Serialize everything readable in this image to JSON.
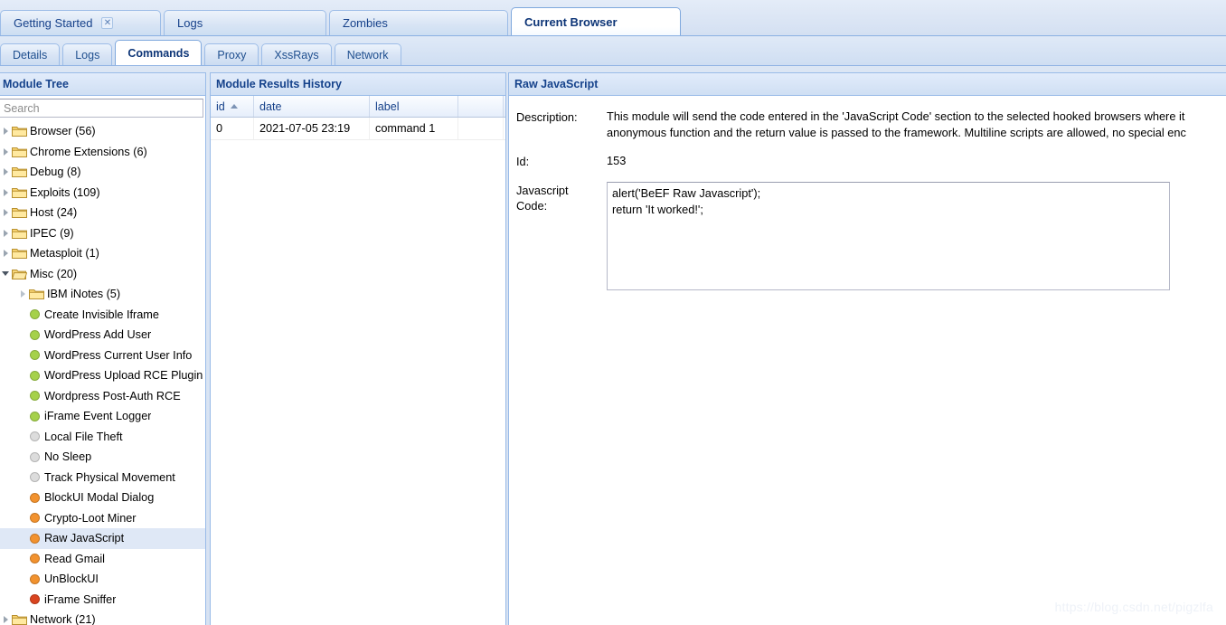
{
  "main_tabs": [
    {
      "label": "Getting Started",
      "active": false,
      "closable": true,
      "cls": "t-getting"
    },
    {
      "label": "Logs",
      "active": false,
      "closable": false,
      "cls": "t-logs"
    },
    {
      "label": "Zombies",
      "active": false,
      "closable": false,
      "cls": "t-zombies"
    },
    {
      "label": "Current Browser",
      "active": true,
      "closable": false,
      "cls": "t-current"
    }
  ],
  "sub_tabs": [
    {
      "label": "Details",
      "active": false
    },
    {
      "label": "Logs",
      "active": false
    },
    {
      "label": "Commands",
      "active": true
    },
    {
      "label": "Proxy",
      "active": false
    },
    {
      "label": "XssRays",
      "active": false
    },
    {
      "label": "Network",
      "active": false
    }
  ],
  "module_tree": {
    "title": "Module Tree",
    "search_placeholder": "Search",
    "search_value": "",
    "nodes": [
      {
        "type": "folder",
        "label": "Browser (56)",
        "depth": 0,
        "expanded": false,
        "selected": false
      },
      {
        "type": "folder",
        "label": "Chrome Extensions (6)",
        "depth": 0,
        "expanded": false,
        "selected": false
      },
      {
        "type": "folder",
        "label": "Debug (8)",
        "depth": 0,
        "expanded": false,
        "selected": false
      },
      {
        "type": "folder",
        "label": "Exploits (109)",
        "depth": 0,
        "expanded": false,
        "selected": false
      },
      {
        "type": "folder",
        "label": "Host (24)",
        "depth": 0,
        "expanded": false,
        "selected": false
      },
      {
        "type": "folder",
        "label": "IPEC (9)",
        "depth": 0,
        "expanded": false,
        "selected": false
      },
      {
        "type": "folder",
        "label": "Metasploit (1)",
        "depth": 0,
        "expanded": false,
        "selected": false
      },
      {
        "type": "folder",
        "label": "Misc (20)",
        "depth": 0,
        "expanded": true,
        "selected": false
      },
      {
        "type": "folder",
        "label": "IBM iNotes (5)",
        "depth": 1,
        "expanded": false,
        "selected": false
      },
      {
        "type": "module",
        "label": "Create Invisible Iframe",
        "depth": 1,
        "status": "green",
        "selected": false
      },
      {
        "type": "module",
        "label": "WordPress Add User",
        "depth": 1,
        "status": "green",
        "selected": false
      },
      {
        "type": "module",
        "label": "WordPress Current User Info",
        "depth": 1,
        "status": "green",
        "selected": false
      },
      {
        "type": "module",
        "label": "WordPress Upload RCE Plugin",
        "depth": 1,
        "status": "green",
        "selected": false
      },
      {
        "type": "module",
        "label": "Wordpress Post-Auth RCE",
        "depth": 1,
        "status": "green",
        "selected": false
      },
      {
        "type": "module",
        "label": "iFrame Event Logger",
        "depth": 1,
        "status": "green",
        "selected": false
      },
      {
        "type": "module",
        "label": "Local File Theft",
        "depth": 1,
        "status": "grey",
        "selected": false
      },
      {
        "type": "module",
        "label": "No Sleep",
        "depth": 1,
        "status": "grey",
        "selected": false
      },
      {
        "type": "module",
        "label": "Track Physical Movement",
        "depth": 1,
        "status": "grey",
        "selected": false
      },
      {
        "type": "module",
        "label": "BlockUI Modal Dialog",
        "depth": 1,
        "status": "orange",
        "selected": false
      },
      {
        "type": "module",
        "label": "Crypto-Loot Miner",
        "depth": 1,
        "status": "orange",
        "selected": false
      },
      {
        "type": "module",
        "label": "Raw JavaScript",
        "depth": 1,
        "status": "orange",
        "selected": true
      },
      {
        "type": "module",
        "label": "Read Gmail",
        "depth": 1,
        "status": "orange",
        "selected": false
      },
      {
        "type": "module",
        "label": "UnBlockUI",
        "depth": 1,
        "status": "orange",
        "selected": false
      },
      {
        "type": "module",
        "label": "iFrame Sniffer",
        "depth": 1,
        "status": "red",
        "selected": false
      },
      {
        "type": "folder",
        "label": "Network (21)",
        "depth": 0,
        "expanded": false,
        "selected": false
      }
    ],
    "status_colors": {
      "green": "#a5d14a",
      "grey": "#dcdcdc",
      "orange": "#f2922e",
      "red": "#d9441f"
    }
  },
  "results_history": {
    "title": "Module Results History",
    "columns": [
      "id",
      "date",
      "label",
      ""
    ],
    "sort_column": "id",
    "sort_direction": "asc",
    "rows": [
      {
        "id": "0",
        "date": "2021-07-05 23:19",
        "label": "command 1",
        "extra": ""
      }
    ]
  },
  "detail": {
    "title": "Raw JavaScript",
    "description_label": "Description:",
    "description_value": "This module will send the code entered in the 'JavaScript Code' section to the selected hooked browsers where it\nanonymous function and the return value is passed to the framework. Multiline scripts are allowed, no special enc",
    "id_label": "Id:",
    "id_value": "153",
    "code_label": "Javascript\nCode:",
    "code_value": "alert('BeEF Raw Javascript');\nreturn 'It worked!';"
  },
  "watermark": "https://blog.csdn.net/pigzlfa"
}
